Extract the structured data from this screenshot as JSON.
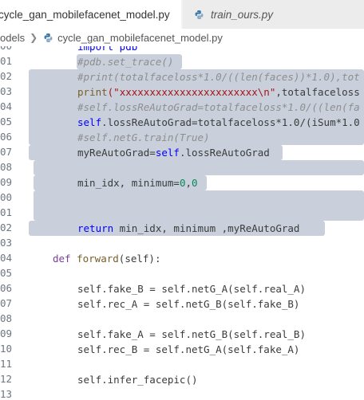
{
  "tabs": [
    {
      "label": "cycle_gan_mobilefacenet_model.py",
      "active": true
    },
    {
      "label": "train_ours.py",
      "active": false
    }
  ],
  "breadcrumb": {
    "folder": "odels",
    "file": "cycle_gan_mobilefacenet_model.py"
  },
  "line_numbers": [
    "00",
    "01",
    "02",
    "03",
    "04",
    "05",
    "06",
    "07",
    "08",
    "09",
    "00",
    "01",
    "02",
    "03",
    "04",
    "05",
    "06",
    "07",
    "08",
    "09",
    "10",
    "11",
    "12",
    "13"
  ],
  "code": {
    "l0": "import pdb",
    "l1": "#pdb.set_trace()",
    "l2": "#print(totalfaceloss*1.0/((len(faces))*1.0),tot",
    "l3_kw": "print",
    "l3_str": "(\"xxxxxxxxxxxxxxxxxxxxxxx\\n\"",
    "l3_rest": ",totalfaceloss",
    "l4": "#self.lossReAutoGrad=totalfaceloss*1.0/((len(fa",
    "l5_a": "self",
    "l5_b": ".lossReAutoGrad=totalfaceloss*1.0/(iSum*1.0",
    "l6": "#self.netG.train(True)",
    "l7_a": "myReAutoGrad=",
    "l7_b": "self",
    "l7_c": ".lossReAutoGrad",
    "l9_a": "min_idx, minimum=",
    "l9_b": "0",
    "l9_c": ",",
    "l9_d": "0",
    "l12_kw": "return",
    "l12_rest": " min_idx, minimum ,myReAutoGrad",
    "l14_kw": "def",
    "l14_fn": "forward",
    "l14_p": "(self):",
    "l16": "self.fake_B = self.netG_A(self.real_A)",
    "l17": "self.rec_A = self.netG_B(self.fake_B)",
    "l19": "self.fake_A = self.netG_B(self.real_B)",
    "l20": "self.rec_B = self.netG_A(self.fake_A)",
    "l22": "self.infer_facepic()"
  },
  "colors": {
    "selection": "#c9d0dc",
    "keyword": "#0000ff",
    "string": "#a31515",
    "number": "#098658",
    "comment": "#8e8e8e",
    "function": "#795e26"
  },
  "icons": [
    "python-file-icon",
    "chevron-right-icon",
    "close-dot-icon"
  ]
}
